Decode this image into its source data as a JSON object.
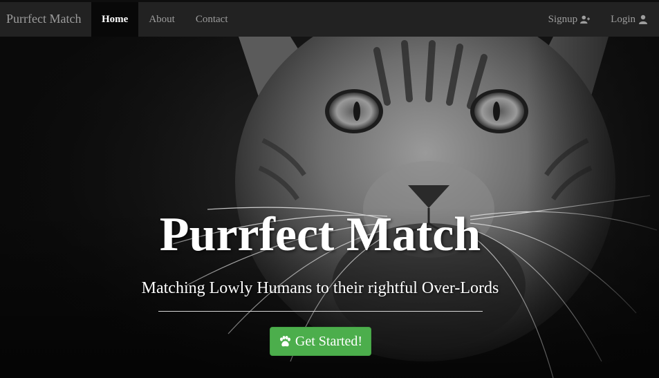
{
  "navbar": {
    "brand": "Purrfect Match",
    "left_items": [
      {
        "label": "Home",
        "active": true
      },
      {
        "label": "About",
        "active": false
      },
      {
        "label": "Contact",
        "active": false
      }
    ],
    "right_items": [
      {
        "label": "Signup",
        "icon": "user-plus-icon"
      },
      {
        "label": "Login",
        "icon": "user-icon"
      }
    ]
  },
  "hero": {
    "title": "Purrfect Match",
    "subtitle": "Matching Lowly Humans to their rightful Over-Lords",
    "cta_label": "Get Started!",
    "cta_icon": "paw-icon",
    "background_image": "black-and-white-cat-photo"
  },
  "colors": {
    "navbar_bg": "#222222",
    "nav_active_bg": "#080808",
    "nav_text": "#9d9d9d",
    "cta_bg": "#4cae4c",
    "text_light": "#ffffff"
  }
}
